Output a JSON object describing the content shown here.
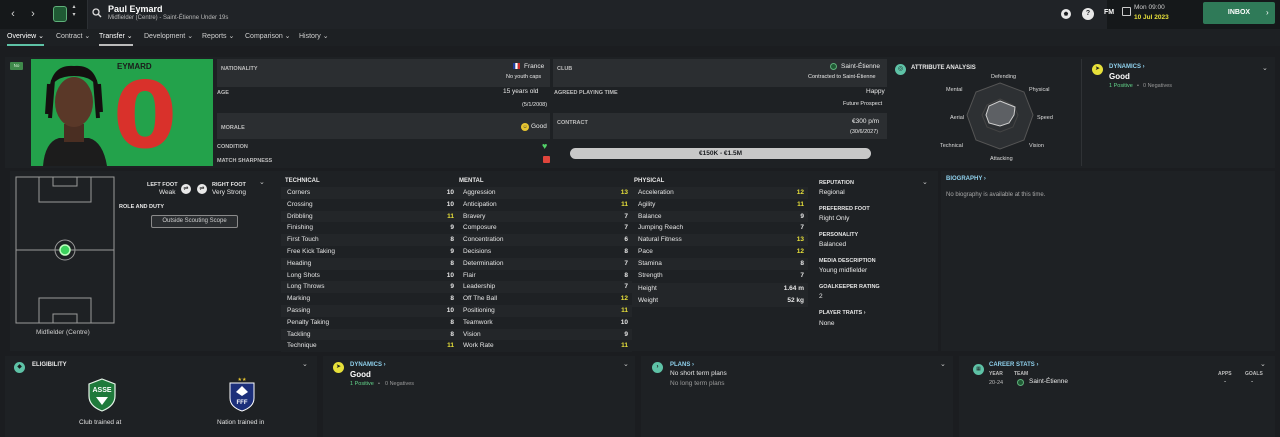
{
  "header": {
    "player_name": "Paul Eymard",
    "player_sub": "Midfielder (Centre) - Saint-Étienne Under 19s",
    "date_day": "Mon 09:00",
    "date_full": "10 Jul 2023",
    "inbox_label": "INBOX",
    "fm_label": "FM",
    "help_label": "?"
  },
  "tabs": [
    {
      "label": "Overview ⌄"
    },
    {
      "label": "Contract ⌄"
    },
    {
      "label": "Transfer ⌄"
    },
    {
      "label": "Development ⌄"
    },
    {
      "label": "Reports ⌄"
    },
    {
      "label": "Comparison ⌄"
    },
    {
      "label": "History ⌄"
    }
  ],
  "profile": {
    "badge": "No",
    "shirt_name": "EYMARD",
    "shirt_number": "0",
    "nationality_label": "NATIONALITY",
    "nationality_value": "France",
    "nationality_sub": "No youth caps",
    "club_label": "CLUB",
    "club_value": "Saint-Étienne",
    "club_sub": "Contracted to Saint-Étienne",
    "age_label": "AGE",
    "age_value": "15 years old",
    "age_sub": "(5/1/2008)",
    "playing_time_label": "AGREED PLAYING TIME",
    "playing_time_value": "Happy",
    "playing_time_sub": "Future Prospect",
    "morale_label": "MORALE",
    "morale_value": "Good",
    "contract_label": "CONTRACT",
    "contract_value": "€300 p/m",
    "contract_sub": "(30/6/2027)",
    "condition_label": "CONDITION",
    "sharpness_label": "MATCH SHARPNESS",
    "value_range": "€150K - €1.5M"
  },
  "attribute_analysis": {
    "title": "ATTRIBUTE ANALYSIS",
    "axes": [
      "Defending",
      "Physical",
      "Speed",
      "Vision",
      "Attacking",
      "Technical",
      "Aerial",
      "Mental"
    ]
  },
  "dynamics_top": {
    "title": "DYNAMICS ›",
    "value": "Good",
    "positives": "1 Positive",
    "sep": "•",
    "negatives": "0 Negatives"
  },
  "pitch": {
    "position_label": "Midfielder (Centre)",
    "left_foot_label": "LEFT FOOT",
    "left_foot_value": "Weak",
    "right_foot_label": "RIGHT FOOT",
    "right_foot_value": "Very Strong",
    "role_label": "ROLE AND DUTY",
    "scouting_button": "Outside Scouting Scope"
  },
  "technical": {
    "title": "TECHNICAL",
    "rows": [
      {
        "name": "Corners",
        "value": "10"
      },
      {
        "name": "Crossing",
        "value": "10"
      },
      {
        "name": "Dribbling",
        "value": "11"
      },
      {
        "name": "Finishing",
        "value": "9"
      },
      {
        "name": "First Touch",
        "value": "8"
      },
      {
        "name": "Free Kick Taking",
        "value": "9"
      },
      {
        "name": "Heading",
        "value": "8"
      },
      {
        "name": "Long Shots",
        "value": "10"
      },
      {
        "name": "Long Throws",
        "value": "9"
      },
      {
        "name": "Marking",
        "value": "8"
      },
      {
        "name": "Passing",
        "value": "10"
      },
      {
        "name": "Penalty Taking",
        "value": "8"
      },
      {
        "name": "Tackling",
        "value": "8"
      },
      {
        "name": "Technique",
        "value": "11"
      }
    ]
  },
  "mental": {
    "title": "MENTAL",
    "rows": [
      {
        "name": "Aggression",
        "value": "13"
      },
      {
        "name": "Anticipation",
        "value": "11"
      },
      {
        "name": "Bravery",
        "value": "7"
      },
      {
        "name": "Composure",
        "value": "7"
      },
      {
        "name": "Concentration",
        "value": "6"
      },
      {
        "name": "Decisions",
        "value": "8"
      },
      {
        "name": "Determination",
        "value": "7"
      },
      {
        "name": "Flair",
        "value": "8"
      },
      {
        "name": "Leadership",
        "value": "7"
      },
      {
        "name": "Off The Ball",
        "value": "12"
      },
      {
        "name": "Positioning",
        "value": "11"
      },
      {
        "name": "Teamwork",
        "value": "10"
      },
      {
        "name": "Vision",
        "value": "9"
      },
      {
        "name": "Work Rate",
        "value": "11"
      }
    ]
  },
  "physical": {
    "title": "PHYSICAL",
    "rows": [
      {
        "name": "Acceleration",
        "value": "12"
      },
      {
        "name": "Agility",
        "value": "11"
      },
      {
        "name": "Balance",
        "value": "9"
      },
      {
        "name": "Jumping Reach",
        "value": "7"
      },
      {
        "name": "Natural Fitness",
        "value": "13"
      },
      {
        "name": "Pace",
        "value": "12"
      },
      {
        "name": "Stamina",
        "value": "8"
      },
      {
        "name": "Strength",
        "value": "7"
      }
    ],
    "height_label": "Height",
    "height_value": "1.64 m",
    "weight_label": "Weight",
    "weight_value": "52 kg"
  },
  "info": {
    "reputation_label": "REPUTATION",
    "reputation_value": "Regional",
    "foot_label": "PREFERRED FOOT",
    "foot_value": "Right Only",
    "personality_label": "PERSONALITY",
    "personality_value": "Balanced",
    "media_label": "MEDIA DESCRIPTION",
    "media_value": "Young midfielder",
    "gk_label": "GOALKEEPER RATING",
    "gk_value": "2",
    "traits_label": "PLAYER TRAITS ›",
    "traits_value": "None"
  },
  "biography": {
    "title": "BIOGRAPHY ›",
    "text": "No biography is available at this time."
  },
  "eligibility": {
    "title": "ELIGIBILITY",
    "club_label": "Club trained at",
    "nation_label": "Nation trained in",
    "club_crest_text": "ASSE",
    "nation_crest_text": "FFF"
  },
  "dynamics_bottom": {
    "title": "DYNAMICS ›",
    "value": "Good",
    "positives": "1 Positive",
    "sep": "•",
    "negatives": "0 Negatives"
  },
  "plans": {
    "title": "PLANS ›",
    "short": "No short term plans",
    "long": "No long term plans"
  },
  "career": {
    "title": "CAREER STATS ›",
    "col_year": "YEAR",
    "col_team": "TEAM",
    "col_apps": "APPS",
    "col_goals": "GOALS",
    "year": "20-24",
    "team": "Saint-Étienne",
    "apps": "-",
    "goals": "-"
  },
  "colors": {
    "accent": "#5ec2a6",
    "highlight_yellow": "#e7e03a",
    "positive_green": "#63d68b",
    "shirt_green": "#22a44a",
    "shirt_red": "#d9312b"
  }
}
